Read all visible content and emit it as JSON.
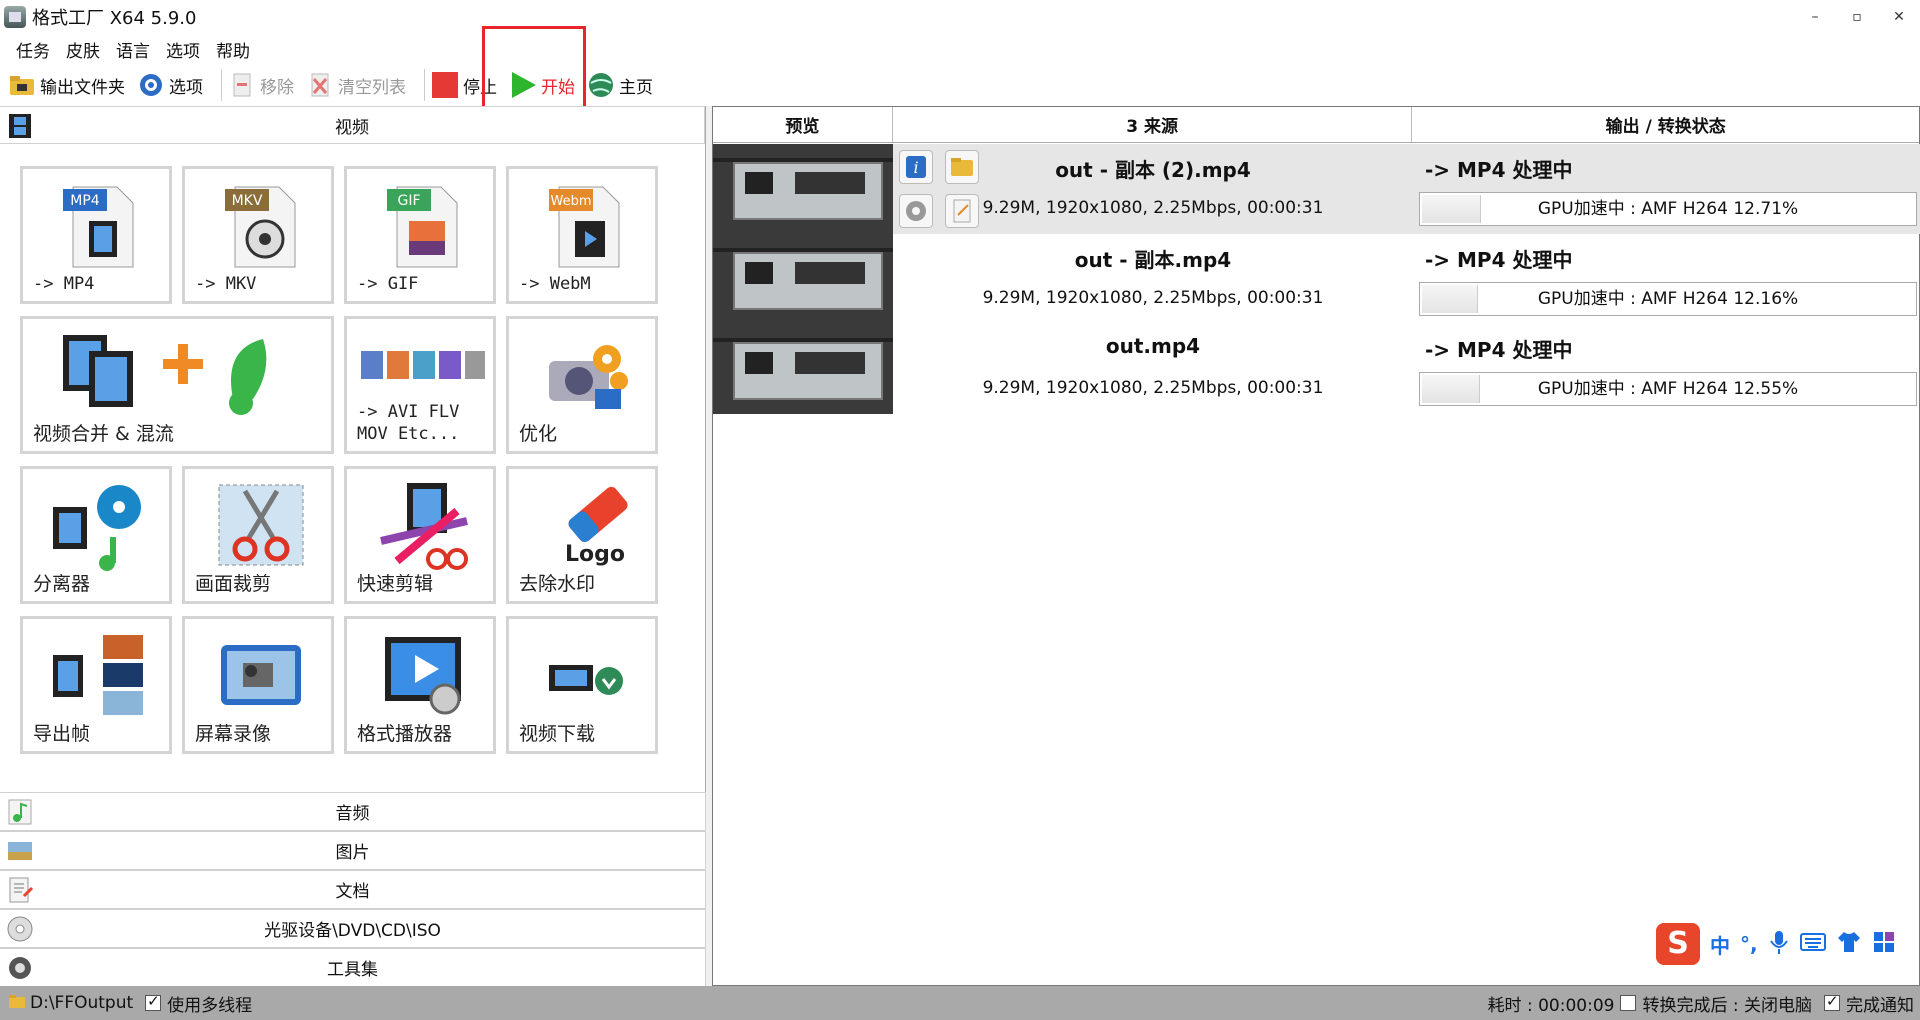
{
  "window": {
    "title": "格式工厂 X64 5.9.0",
    "controls": [
      "–",
      "▫",
      "✕"
    ]
  },
  "menu": [
    "任务",
    "皮肤",
    "语言",
    "选项",
    "帮助"
  ],
  "toolbar": {
    "output_folder": "输出文件夹",
    "options": "选项",
    "remove": "移除",
    "clear_list": "清空列表",
    "stop": "停止",
    "start": "开始",
    "home": "主页"
  },
  "left": {
    "video_header": "视频",
    "tiles": [
      {
        "label": "-> MP4",
        "badge": "MP4"
      },
      {
        "label": "-> MKV",
        "badge": "MKV"
      },
      {
        "label": "-> GIF",
        "badge": "GIF"
      },
      {
        "label": "-> WebM",
        "badge": "Webm"
      },
      {
        "label": "视频合并 & 混流"
      },
      {
        "label": "-> AVI FLV\nMOV Etc..."
      },
      {
        "label": "优化"
      },
      {
        "label": "分离器"
      },
      {
        "label": "画面裁剪"
      },
      {
        "label": "快速剪辑"
      },
      {
        "label": "去除水印",
        "art_text": "Logo"
      },
      {
        "label": "导出帧"
      },
      {
        "label": "屏幕录像"
      },
      {
        "label": "格式播放器"
      },
      {
        "label": "视频下载"
      }
    ],
    "categories": [
      "音频",
      "图片",
      "文档",
      "光驱设备\\DVD\\CD\\ISO",
      "工具集"
    ]
  },
  "table": {
    "headers": [
      "预览",
      "3 来源",
      "输出 / 转换状态"
    ],
    "rows": [
      {
        "name": "out - 副本 (2).mp4",
        "meta": "9.29M, 1920x1080, 2.25Mbps, 00:00:31",
        "status": "-> MP4 处理中",
        "progress_text": "GPU加速中 : AMF H264 12.71%",
        "progress": 12.71
      },
      {
        "name": "out - 副本.mp4",
        "meta": "9.29M, 1920x1080, 2.25Mbps, 00:00:31",
        "status": "-> MP4 处理中",
        "progress_text": "GPU加速中 : AMF H264 12.16%",
        "progress": 12.16
      },
      {
        "name": "out.mp4",
        "meta": "9.29M, 1920x1080, 2.25Mbps, 00:00:31",
        "status": "-> MP4 处理中",
        "progress_text": "GPU加速中 : AMF H264 12.55%",
        "progress": 12.55
      }
    ]
  },
  "statusbar": {
    "output_path": "D:\\FFOutput",
    "multithread": "使用多线程",
    "elapsed": "耗时 : 00:00:09",
    "after_done": "转换完成后 : 关闭电脑",
    "notify": "完成通知"
  },
  "ime": {
    "logo": "S",
    "mode": "中",
    "punct": "°,"
  },
  "colors": {
    "highlight_frame": "#e8252c",
    "start_green": "#2db52d",
    "stop_red": "#e53935"
  }
}
